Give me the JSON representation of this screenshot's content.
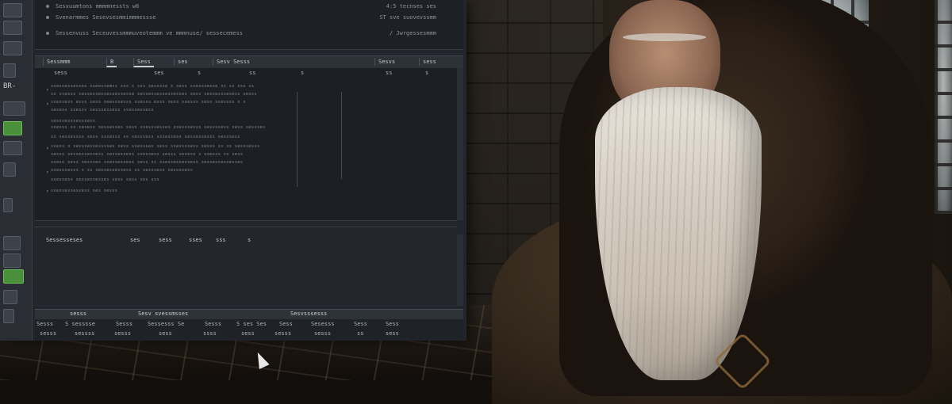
{
  "colors": {
    "accent_green": "#4a8f3c",
    "editor_bg": "#22262c",
    "panel_bg": "#1c2025"
  },
  "toolbar": {
    "items": [
      {
        "icon": "panel-icon",
        "label": ""
      },
      {
        "icon": "layers-icon",
        "label": ""
      },
      {
        "icon": "grid-icon",
        "label": ""
      },
      {
        "icon": "text-icon",
        "label": "BR-"
      },
      {
        "icon": "table-icon",
        "label": ""
      },
      {
        "icon": "active-tool-icon",
        "label": ""
      },
      {
        "icon": "image-icon",
        "label": ""
      },
      {
        "icon": "bar-icon",
        "label": ""
      },
      {
        "icon": "list-icon",
        "label": ""
      },
      {
        "icon": "green-tool-icon",
        "label": ""
      }
    ]
  },
  "top_panel": {
    "rows": [
      {
        "left": "Sesxuumtons  mmmmnessts w6",
        "right": "4:5 tecnses ses"
      },
      {
        "left": "Svenarmmes   Sesevsesmmimmmessse",
        "right": "ST sve suovevssmm"
      },
      {
        "left": "Sessenvuss   Seceuvessmmmuveotemmm ve mmmnuse/ sessecemess",
        "right": "/ Jwrgessesmmm"
      }
    ]
  },
  "tabs": [
    "Sessmmm",
    "B",
    "Sess",
    "ses",
    "Sesv Sesss",
    "Sesvs",
    "sess"
  ],
  "code_header": [
    "sess",
    "ses",
    "s",
    "ss",
    "s",
    "ss",
    "s"
  ],
  "code_lines": [
    "ssessessesses sseessemss sss s sss sesssse s sess ssesssesse ss ss sss ss",
    "ss ssesss sessessessessessesse sessessessessesses sess sessesssesess sesss",
    "ssessess esss sess seesssesss ssesss esss sess ssesss sess ssessss s s",
    "sesess ssesss sesssessess ssessessess",
    "sesssesssesssess",
    "ssesss ss sesess sessesses sess ssesssesses ssesssesss sessssess sess sessses",
    "ss sessessss sess sssesss ss sesssess sssessess sessessesss sesssess",
    "ssess s sesssessesssses sess ssessses sess ssessssess sesss ss ss sesssesss",
    "sesss sessessessess sessessess ssessess sesss sesess s ssesss ss sess",
    "ssess sess sessses  ssessessess sess ss  ssessessessess sessessessesses",
    "ssesssesss  s ss sessessessess ss sesssess sessssess",
    "ssessess  sessessesses sess sess ses  sss",
    "ssessessessess ses sesss"
  ],
  "lower_panel": {
    "header": [
      "Sessesseses",
      "ses",
      "sess",
      "sses",
      "sss",
      "s"
    ]
  },
  "status_bar": [
    "sesss",
    "Sesv svessmsses",
    "Sesvsssesss"
  ],
  "footer_rows": [
    [
      "Sesss",
      "S sesssse",
      "Sesss",
      "Sessesss Se",
      "Sesss",
      "S ses Ses",
      "Sess",
      "Sesesss",
      "Sess",
      "Sess"
    ],
    [
      "sesss",
      "sessss",
      "sesss",
      "sess",
      "ssss",
      "sess",
      "sesss",
      "sesss",
      "ss",
      "sess"
    ]
  ]
}
